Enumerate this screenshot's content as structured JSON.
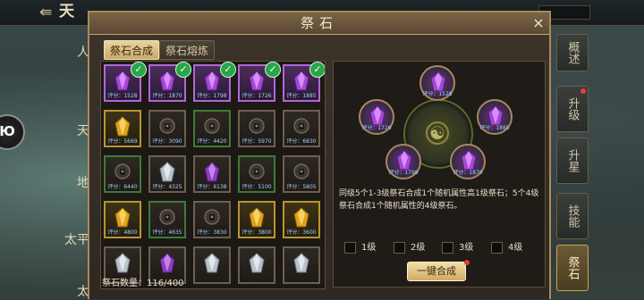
{
  "background": {
    "title": "天",
    "left_tabs": [
      "人",
      "天",
      "地",
      "太平",
      "太"
    ],
    "logo_text": "Ю"
  },
  "side_tabs": [
    {
      "label": "概述",
      "active": false,
      "dot": false
    },
    {
      "label": "升级",
      "active": false,
      "dot": true
    },
    {
      "label": "升星",
      "active": false,
      "dot": false
    },
    {
      "label": "技能",
      "active": false,
      "dot": false
    },
    {
      "label": "祭石",
      "active": true,
      "dot": false
    }
  ],
  "modal": {
    "title": "祭石",
    "close": "×",
    "tabs": [
      "祭石合成",
      "祭石熔炼"
    ],
    "active_tab": 0
  },
  "inventory": {
    "count_label": "祭石数量：",
    "count_value": "116/400",
    "slots": [
      {
        "kind": "purple",
        "score": "评分：1528",
        "checked": true
      },
      {
        "kind": "purple",
        "score": "评分：1870",
        "checked": true
      },
      {
        "kind": "purple",
        "score": "评分：1798",
        "checked": true
      },
      {
        "kind": "purple",
        "score": "评分：1726",
        "checked": true
      },
      {
        "kind": "purple",
        "score": "评分：1885",
        "checked": true
      },
      {
        "kind": "gold",
        "score": "评分：5669",
        "checked": false
      },
      {
        "kind": "dark",
        "score": "评分：3090",
        "checked": false
      },
      {
        "kind": "dark",
        "score": "评分：4420",
        "checked": false
      },
      {
        "kind": "dark",
        "score": "评分：5970",
        "checked": false
      },
      {
        "kind": "dark",
        "score": "评分：6830",
        "checked": false
      },
      {
        "kind": "dark",
        "score": "评分：6440",
        "checked": false
      },
      {
        "kind": "silver",
        "score": "评分：4325",
        "checked": false
      },
      {
        "kind": "purple2",
        "score": "评分：6138",
        "checked": false
      },
      {
        "kind": "dark",
        "score": "评分：5100",
        "checked": false
      },
      {
        "kind": "dark",
        "score": "评分：5805",
        "checked": false
      },
      {
        "kind": "gold",
        "score": "评分：4800",
        "checked": false
      },
      {
        "kind": "dark",
        "score": "评分：4635",
        "checked": false
      },
      {
        "kind": "dark",
        "score": "评分：3830",
        "checked": false
      },
      {
        "kind": "gold",
        "score": "评分：3800",
        "checked": false
      },
      {
        "kind": "gold",
        "score": "评分：3600",
        "checked": false
      },
      {
        "kind": "silver",
        "score": "",
        "checked": false
      },
      {
        "kind": "purple2",
        "score": "",
        "checked": false
      },
      {
        "kind": "silver",
        "score": "",
        "checked": false
      },
      {
        "kind": "silver",
        "score": "",
        "checked": false
      },
      {
        "kind": "silver",
        "score": "",
        "checked": false
      }
    ]
  },
  "fusion": {
    "slots": [
      {
        "score": "评分：1528"
      },
      {
        "score": "评分：1726"
      },
      {
        "score": "评分：1885"
      },
      {
        "score": "评分：1798"
      },
      {
        "score": "评分：1870"
      }
    ],
    "description": "同级5个1-3级祭石合成1个随机属性高1级祭石；5个4级祭石合成1个随机属性的4级祭石。",
    "levels": [
      "1级",
      "2级",
      "3级",
      "4级"
    ],
    "merge_button": "一键合成"
  },
  "colors": {
    "accent_gold": "#c9ab6a",
    "check_green": "#27a64a",
    "purple_gem": "#b067d8",
    "red_dot": "#e0403a"
  }
}
